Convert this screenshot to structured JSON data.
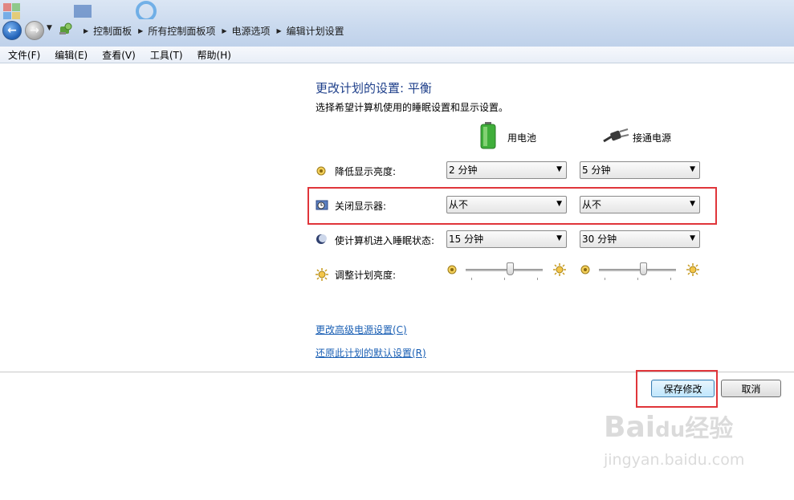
{
  "address_bar": {
    "breadcrumbs": [
      "控制面板",
      "所有控制面板项",
      "电源选项",
      "编辑计划设置"
    ]
  },
  "menu": {
    "items": [
      "文件(F)",
      "编辑(E)",
      "查看(V)",
      "工具(T)",
      "帮助(H)"
    ]
  },
  "main": {
    "title": "更改计划的设置: 平衡",
    "subtitle": "选择希望计算机使用的睡眠设置和显示设置。",
    "columns": {
      "battery": "用电池",
      "plugged": "接通电源"
    },
    "rows": {
      "dim": {
        "label": "降低显示亮度:",
        "battery": "2 分钟",
        "plugged": "5 分钟"
      },
      "display_off": {
        "label": "关闭显示器:",
        "battery": "从不",
        "plugged": "从不"
      },
      "sleep": {
        "label": "使计算机进入睡眠状态:",
        "battery": "15 分钟",
        "plugged": "30 分钟"
      },
      "brightness": {
        "label": "调整计划亮度:",
        "battery_level": 0.58,
        "plugged_level": 0.58
      }
    },
    "links": {
      "advanced": "更改高级电源设置(C)",
      "restore": "还原此计划的默认设置(R)"
    }
  },
  "buttons": {
    "save": "保存修改",
    "cancel": "取消"
  },
  "watermark": {
    "brand": "Bai",
    "brand2": "du",
    "brand3": "经验",
    "url": "jingyan.baidu.com"
  },
  "colors": {
    "title": "#1e3f8a",
    "link": "#1a5fb4",
    "highlight": "#e0353a"
  }
}
